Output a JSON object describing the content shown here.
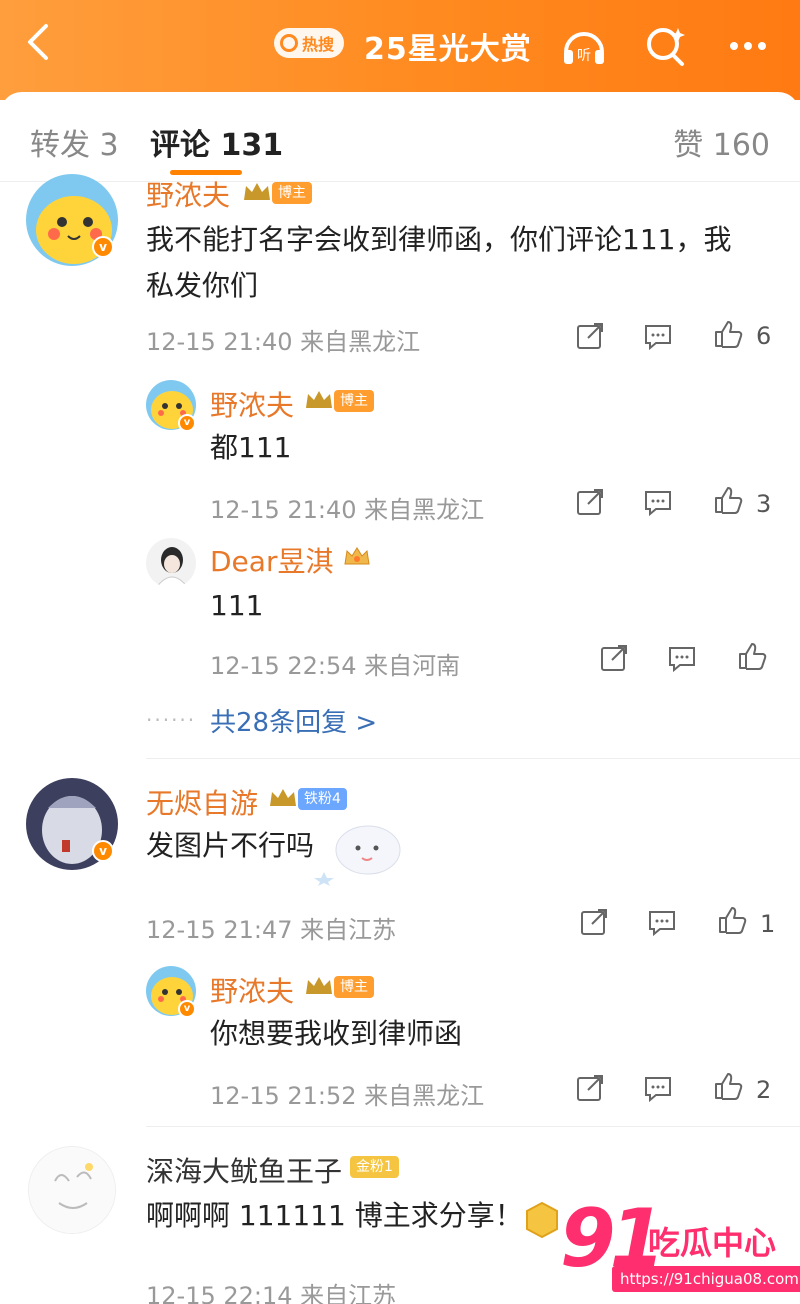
{
  "header": {
    "hot_label": "热搜",
    "title": "25星光大赏",
    "listen_label": "听"
  },
  "tabs": {
    "repost": "转发 3",
    "comment": "评论 131",
    "like": "赞 160"
  },
  "comments": [
    {
      "user": "野浓夫",
      "tag": "博主",
      "text_line1": "我不能打名字会收到律师函，你们评论111，我",
      "text_line2": "私发你们",
      "meta": "12-15 21:40 来自黑龙江",
      "likes": "6",
      "replies": [
        {
          "user": "野浓夫",
          "tag": "博主",
          "text": "都111",
          "meta": "12-15 21:40 来自黑龙江",
          "likes": "3"
        },
        {
          "user": "Dear昱淇",
          "text": "111",
          "meta": "12-15 22:54 来自河南",
          "likes": ""
        }
      ],
      "more_replies": "共28条回复 >"
    },
    {
      "user": "无烬自游",
      "tag": "铁粉4",
      "text": "发图片不行吗",
      "meta": "12-15 21:47 来自江苏",
      "likes": "1",
      "replies": [
        {
          "user": "野浓夫",
          "tag": "博主",
          "text": "你想要我收到律师函",
          "meta": "12-15 21:52 来自黑龙江",
          "likes": "2"
        }
      ]
    },
    {
      "user": "深海大鱿鱼王子",
      "tag": "金粉1",
      "text": "啊啊啊 111111 博主求分享！",
      "meta": "12-15 22:14 来自江苏"
    }
  ],
  "watermark": {
    "number": "91",
    "name": "吃瓜中心",
    "url": "https://91chigua08.com"
  },
  "colors": {
    "accent": "#ff8200",
    "username": "#e8782a",
    "link": "#3a6fb5",
    "header_bg": "#ff8a1f"
  }
}
